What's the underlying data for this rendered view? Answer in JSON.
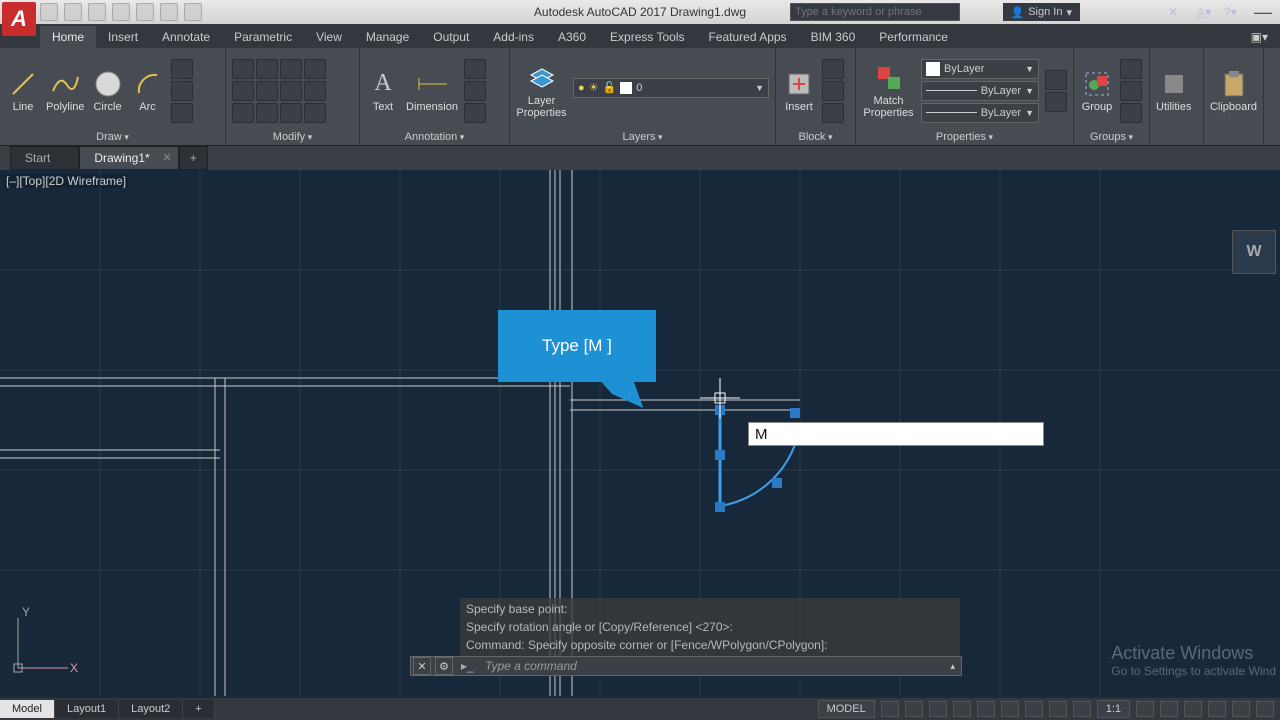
{
  "titlebar": {
    "app_title": "Autodesk AutoCAD 2017   Drawing1.dwg",
    "search_placeholder": "Type a keyword or phrase",
    "signin": "Sign In",
    "minimize": "—"
  },
  "tabs": [
    "Home",
    "Insert",
    "Annotate",
    "Parametric",
    "View",
    "Manage",
    "Output",
    "Add-ins",
    "A360",
    "Express Tools",
    "Featured Apps",
    "BIM 360",
    "Performance"
  ],
  "active_tab": 0,
  "ribbon": {
    "draw": {
      "title": "Draw",
      "items": [
        "Line",
        "Polyline",
        "Circle",
        "Arc"
      ]
    },
    "modify": {
      "title": "Modify"
    },
    "annotation": {
      "title": "Annotation",
      "items": [
        "Text",
        "Dimension"
      ]
    },
    "layers": {
      "title": "Layers",
      "btn": "Layer Properties",
      "current": "0"
    },
    "block": {
      "title": "Block",
      "btn": "Insert"
    },
    "properties": {
      "title": "Properties",
      "btn": "Match Properties",
      "bylayer": "ByLayer"
    },
    "groups": {
      "title": "Groups",
      "btn": "Group"
    },
    "utilities": {
      "title": "Utilities"
    },
    "clipboard": {
      "title": "Clipboard"
    }
  },
  "doctabs": {
    "start": "Start",
    "drawing": "Drawing1*"
  },
  "viewport_label": "[–][Top][2D Wireframe]",
  "viewcube": "W",
  "callout_text": "Type [M ]",
  "dynamic_input": "M",
  "cmd_history": [
    "Specify base point:",
    "Specify rotation angle or [Copy/Reference] <270>:",
    "Command: Specify opposite corner or [Fence/WPolygon/CPolygon]:"
  ],
  "cmd_placeholder": "Type a command",
  "watermark": {
    "line1": "Activate Windows",
    "line2": "Go to Settings to activate Wind"
  },
  "status": {
    "model": "Model",
    "layout1": "Layout1",
    "layout2": "Layout2",
    "model_label": "MODEL",
    "scale": "1:1"
  }
}
